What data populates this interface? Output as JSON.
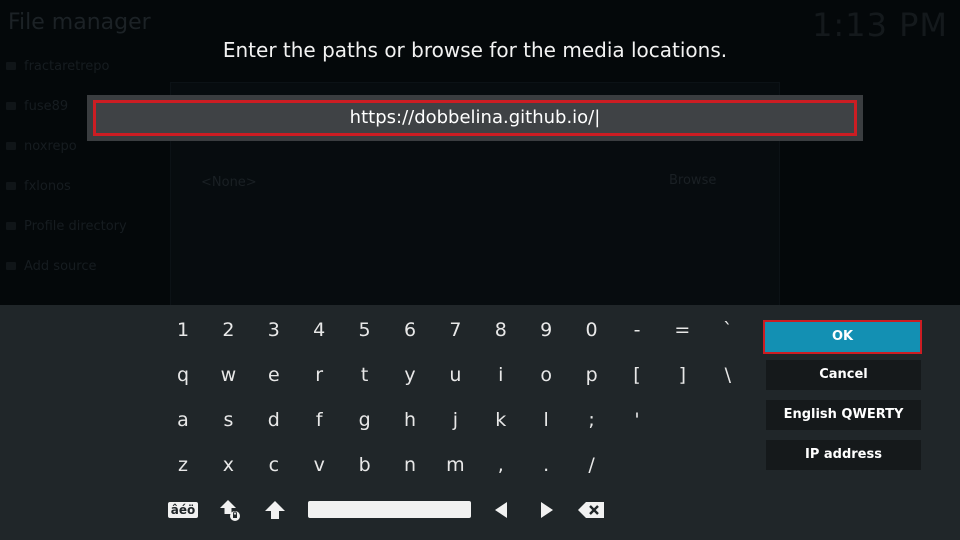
{
  "background": {
    "title": "File manager",
    "clock": "1:13 PM",
    "list_items": [
      "fractaretrepo",
      "fuse89",
      "noxrepo",
      "fxlonos",
      "Profile directory",
      "Add source",
      ""
    ],
    "dialog_none": "<None>",
    "dialog_browse": "Browse"
  },
  "dialog": {
    "heading": "Enter the paths or browse for the media locations.",
    "input_value": "https://dobbelina.github.io/|"
  },
  "keyboard": {
    "row1": [
      "1",
      "2",
      "3",
      "4",
      "5",
      "6",
      "7",
      "8",
      "9",
      "0",
      "-",
      "=",
      "`"
    ],
    "row2": [
      "q",
      "w",
      "e",
      "r",
      "t",
      "y",
      "u",
      "i",
      "o",
      "p",
      "[",
      "]",
      "\\"
    ],
    "row3": [
      "a",
      "s",
      "d",
      "f",
      "g",
      "h",
      "j",
      "k",
      "l",
      ";",
      "'"
    ],
    "row4": [
      "z",
      "x",
      "c",
      "v",
      "b",
      "n",
      "m",
      ",",
      ".",
      "/"
    ],
    "symbols_label": "âéö",
    "icons": [
      "symbols-key",
      "shift-lock-icon",
      "shift-icon",
      "space-key",
      "cursor-left-icon",
      "cursor-right-icon",
      "backspace-icon"
    ]
  },
  "buttons": {
    "ok": "OK",
    "cancel": "Cancel",
    "layout": "English QWERTY",
    "ip": "IP address"
  },
  "colors": {
    "accent": "#1390b3",
    "focus_border": "#cc1d23",
    "panel": "#202629",
    "button": "#15191b"
  }
}
